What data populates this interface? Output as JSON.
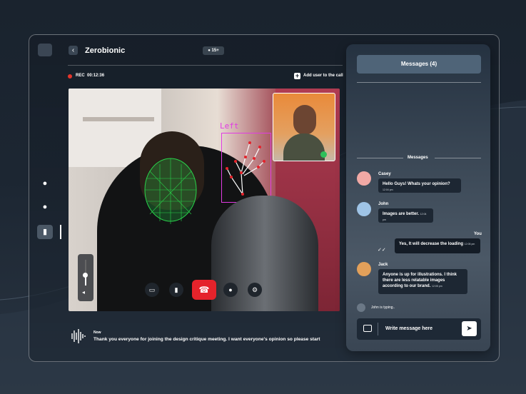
{
  "header": {
    "title": "Zerobionic",
    "participants_badge": "15+"
  },
  "recording": {
    "label": "REC",
    "time": "00:12:36"
  },
  "actions": {
    "add_user": "Add user to the call"
  },
  "video": {
    "hand_label": "Left"
  },
  "controls": {
    "share_icon": "screen-share-icon",
    "camera_icon": "camera-icon",
    "end_icon": "phone-end-icon",
    "mic_icon": "microphone-icon",
    "settings_icon": "settings-icon",
    "volume_level": 0.4
  },
  "transcript": {
    "time_label": "Now",
    "text": "Thank you everyone for joining the design critique meeting. I want everyone's opinion so please start"
  },
  "messages": {
    "header": "Messages (4)",
    "section_label": "Messages",
    "items": [
      {
        "sender": "Casey",
        "text": "Hello Guys! Whats your opinion?",
        "time": "12:04 pm"
      },
      {
        "sender": "John",
        "text": "Images are better.",
        "time": "12:04 pm"
      },
      {
        "sender": "You",
        "text": "Yes, It will decrease the loading",
        "time": "12:05 pm"
      },
      {
        "sender": "Jack",
        "text": "Anyone is up for illustrations. I think there are less relatable images according to our brand.",
        "time": "12:05 pm"
      }
    ],
    "typing_status": "John is typing..",
    "composer_placeholder": "Write message here"
  },
  "colors": {
    "accent": "#e5232b",
    "live": "#2fbf5a",
    "tracking": "#e13be3",
    "face_mesh": "#29d34a"
  }
}
